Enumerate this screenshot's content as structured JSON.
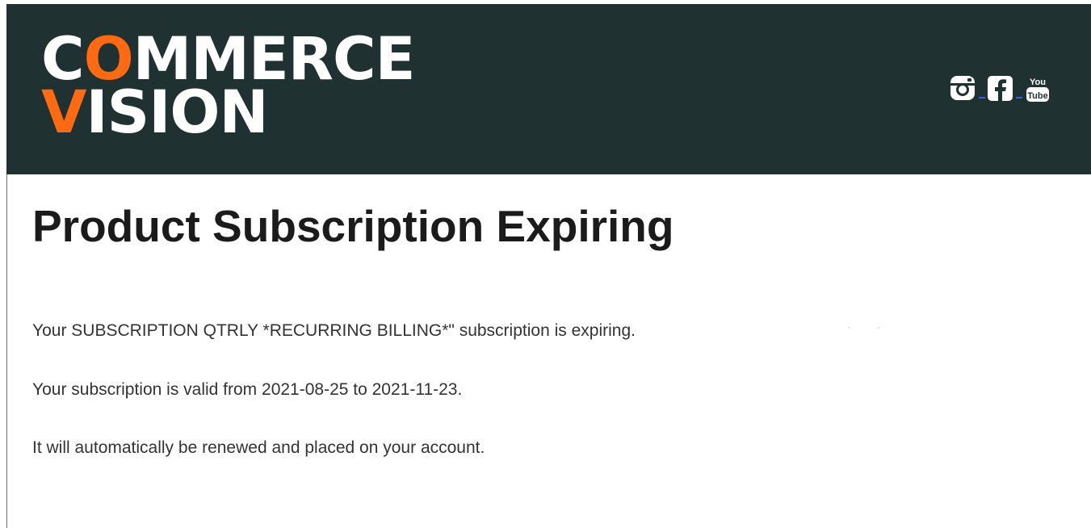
{
  "header": {
    "logo": {
      "line1_accent": "O",
      "line1_pre": "C",
      "line1_post": "MMERCE",
      "line2_accent": "V",
      "line2_post": "ISION"
    },
    "social_icons": [
      {
        "icon": "instagram-icon"
      },
      {
        "icon": "facebook-icon"
      },
      {
        "icon": "youtube-icon",
        "top": "You",
        "bottom": "Tube"
      }
    ]
  },
  "colors": {
    "header_bg": "#203132",
    "accent": "#ff6a13",
    "title": "#1b1b1b",
    "body_text": "#333333"
  },
  "content": {
    "title": "Product Subscription Expiring",
    "paragraphs": [
      "Your SUBSCRIPTION QTRLY *RECURRING BILLING*\" subscription is expiring.",
      "Your subscription is valid from 2021-08-25 to 2021-11-23.",
      "It will automatically be renewed and placed on your account."
    ]
  }
}
